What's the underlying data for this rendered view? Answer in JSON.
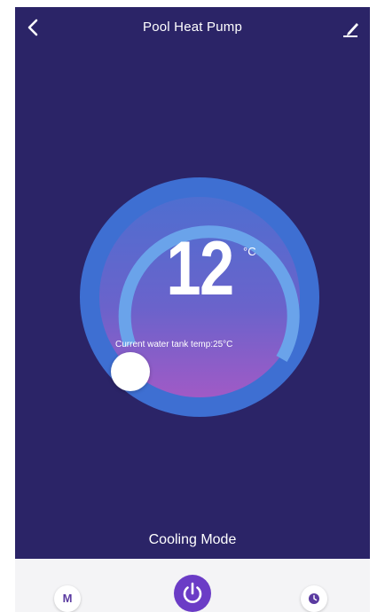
{
  "header": {
    "title": "Pool Heat Pump",
    "back_icon": "chevron-left-icon",
    "edit_icon": "pencil-icon"
  },
  "thermostat": {
    "set_temperature": "12",
    "unit": "°C",
    "current_temp_text": "Current water tank temp:25°C"
  },
  "mode": {
    "label": "Cooling Mode"
  },
  "bottom_bar": {
    "mode_button_label": "M",
    "power_icon": "power-icon",
    "timer_icon": "clock-icon"
  },
  "colors": {
    "background": "#2b2467",
    "dial_ring": "#3e6fd2",
    "dial_ring_light": "#6aa3ea",
    "dial_fill_top": "#4f6ed0",
    "dial_fill_bottom": "#a05ac6",
    "accent": "#6b3cc6",
    "bottom_bar": "#f4f4f6"
  }
}
